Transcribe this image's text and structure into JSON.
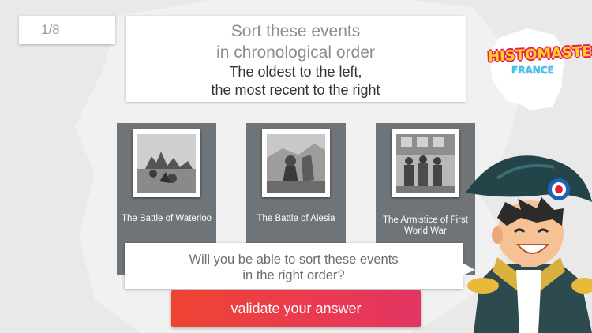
{
  "progress": {
    "text": "1/8"
  },
  "instructions": {
    "line1": "Sort these events",
    "line2": "in chronological order",
    "line3": "The oldest to the left,",
    "line4": "the most recent to the right"
  },
  "logo": {
    "main": "HISTOMASTER",
    "sub": "FRANCE"
  },
  "cards": [
    {
      "label": "The Battle of Waterloo",
      "icon": "waterloo-painting"
    },
    {
      "label": "The Battle of Alesia",
      "icon": "alesia-painting"
    },
    {
      "label": "The Armistice of First World War",
      "icon": "armistice-photo"
    }
  ],
  "prompt": {
    "line1": "Will you be able to sort these events",
    "line2": "in the right order?"
  },
  "validate": {
    "label": "validate your answer"
  },
  "colors": {
    "card_bg": "#6f7478",
    "button_start": "#ee4431",
    "button_end": "#e23562",
    "logo_yellow": "#ffd21f",
    "logo_pink": "#e8215a",
    "logo_blue": "#3ec3ef"
  }
}
